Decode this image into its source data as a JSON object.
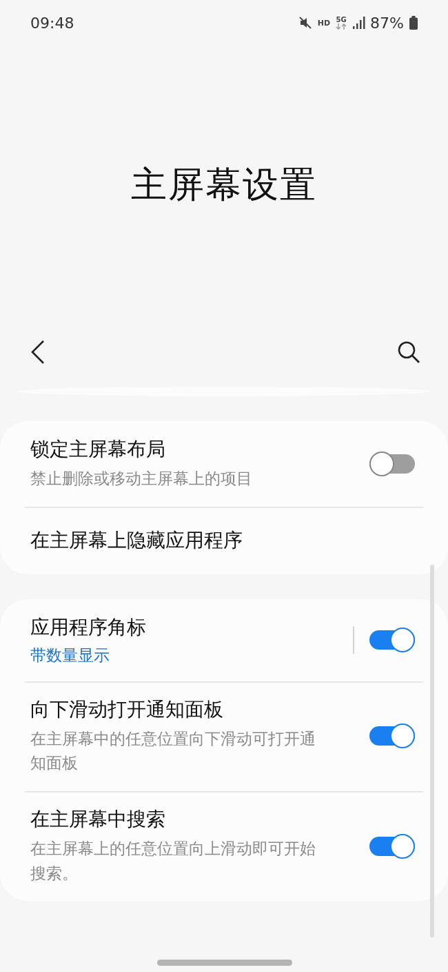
{
  "status_bar": {
    "time": "09:48",
    "network_label": "HD",
    "network_type": "5G",
    "battery": "87%"
  },
  "title": "主屏幕设置",
  "groups": [
    {
      "items": [
        {
          "kind": "toggle",
          "title": "锁定主屏幕布局",
          "summary": "禁止删除或移动主屏幕上的项目",
          "on": false
        },
        {
          "kind": "plain",
          "title": "在主屏幕上隐藏应用程序"
        }
      ]
    },
    {
      "items": [
        {
          "kind": "split-toggle",
          "title": "应用程序角标",
          "value": "带数量显示",
          "on": true
        },
        {
          "kind": "toggle",
          "title": "向下滑动打开通知面板",
          "summary": "在主屏幕中的任意位置向下滑动可打开通知面板",
          "on": true
        },
        {
          "kind": "toggle",
          "title": "在主屏幕中搜索",
          "summary": "在主屏幕上的任意位置向上滑动即可开始搜索。",
          "on": true
        }
      ]
    }
  ]
}
